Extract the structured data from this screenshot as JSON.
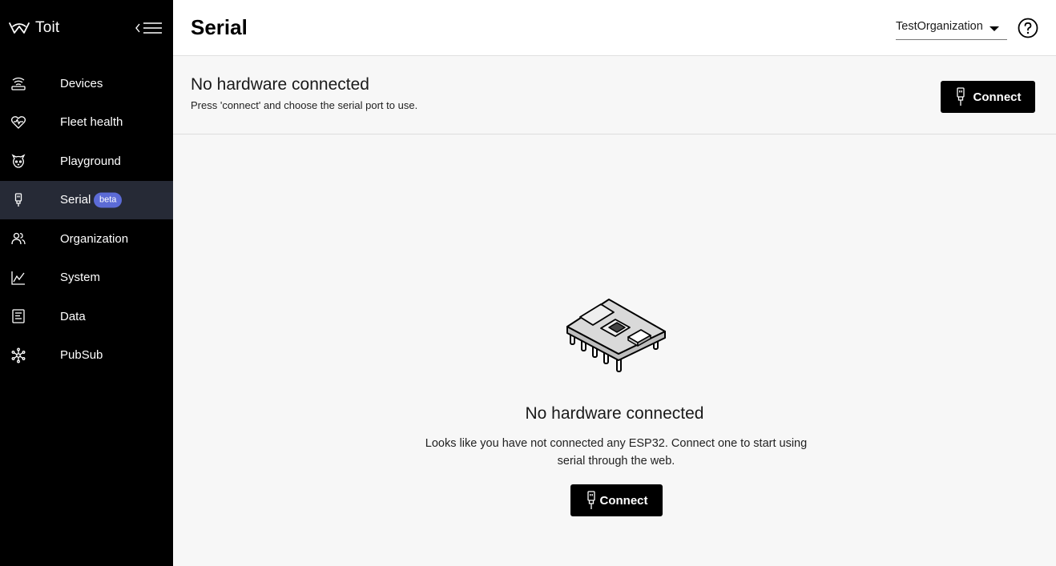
{
  "brand": {
    "name": "Toit"
  },
  "sidebar": {
    "items": [
      {
        "label": "Devices",
        "icon": "router-icon",
        "active": false
      },
      {
        "label": "Fleet health",
        "icon": "heart-pulse-icon",
        "active": false
      },
      {
        "label": "Playground",
        "icon": "cat-icon",
        "active": false
      },
      {
        "label": "Serial",
        "icon": "usb-plug-icon",
        "active": true,
        "badge": "beta"
      },
      {
        "label": "Organization",
        "icon": "users-icon",
        "active": false
      },
      {
        "label": "System",
        "icon": "line-chart-icon",
        "active": false
      },
      {
        "label": "Data",
        "icon": "document-list-icon",
        "active": false
      },
      {
        "label": "PubSub",
        "icon": "network-hub-icon",
        "active": false
      }
    ]
  },
  "header": {
    "title": "Serial",
    "organization": "TestOrganization"
  },
  "status": {
    "title": "No hardware connected",
    "subtitle": "Press 'connect' and choose the serial port to use.",
    "connect_label": "Connect"
  },
  "empty_state": {
    "title": "No hardware connected",
    "text": "Looks like you have not connected any ESP32. Connect one to start using serial through the web.",
    "connect_label": "Connect"
  },
  "colors": {
    "sidebar_bg": "#000000",
    "active_item_bg": "#262a36",
    "beta_badge": "#5c6bd6",
    "button_bg": "#000000",
    "content_bg": "#f7f7f7"
  }
}
